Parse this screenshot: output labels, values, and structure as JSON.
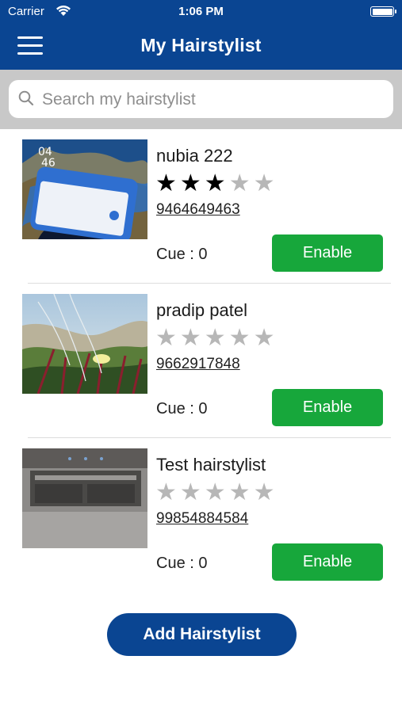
{
  "status_bar": {
    "carrier": "Carrier",
    "time": "1:06 PM"
  },
  "header": {
    "title": "My Hairstylist"
  },
  "search": {
    "placeholder": "Search my hairstylist"
  },
  "stylists": [
    {
      "name": "nubia 222",
      "rating": 3,
      "max_rating": 5,
      "stars": "★★★",
      "empty_stars": "★★",
      "phone": "9464649463",
      "cue": "Cue : 0",
      "button": "Enable"
    },
    {
      "name": "pradip patel",
      "rating": 0,
      "max_rating": 5,
      "stars": "",
      "empty_stars": "★★★★★",
      "phone": "9662917848",
      "cue": "Cue : 0",
      "button": "Enable"
    },
    {
      "name": "Test hairstylist",
      "rating": 0,
      "max_rating": 5,
      "stars": "",
      "empty_stars": "★★★★★",
      "phone": "99854884584",
      "cue": "Cue : 0",
      "button": "Enable"
    }
  ],
  "add_button": "Add Hairstylist",
  "colors": {
    "primary": "#0a4592",
    "enable": "#17a73b",
    "search_bg": "#c8c8c8"
  }
}
